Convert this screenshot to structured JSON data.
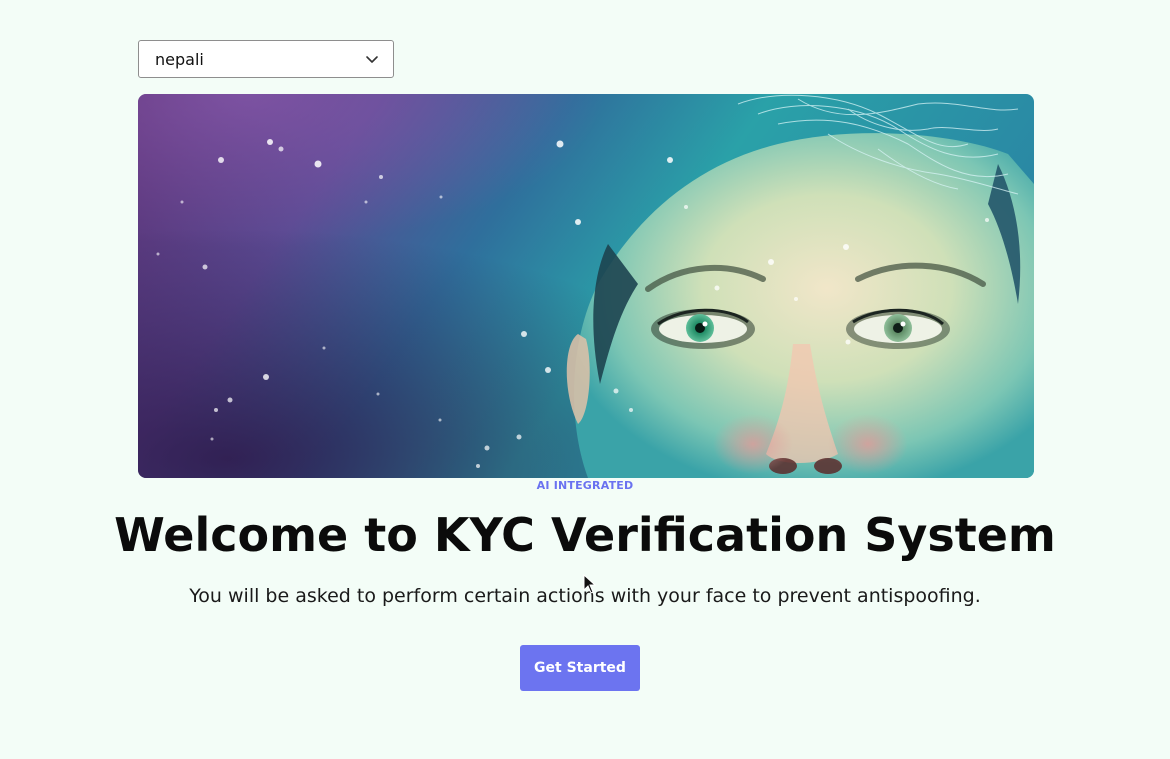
{
  "language_select": {
    "value": "nepali",
    "icon": "chevron-down-icon"
  },
  "hero": {
    "image": "ai-face-illustration"
  },
  "badge": "AI INTEGRATED",
  "title": "Welcome to KYC Verification System",
  "subtitle": "You will be asked to perform certain actions with your face to prevent antispoofing.",
  "cta_label": "Get Started",
  "colors": {
    "background": "#f3fdf7",
    "accent": "#6c74f0"
  }
}
